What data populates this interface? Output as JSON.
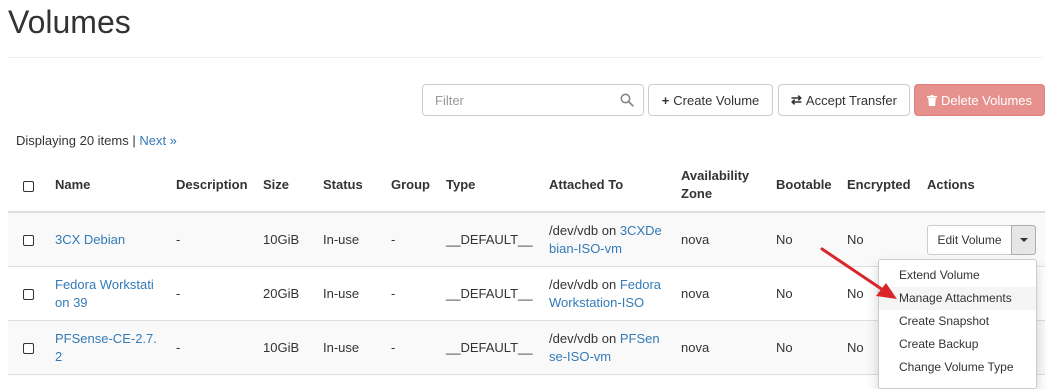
{
  "page": {
    "title": "Volumes"
  },
  "toolbar": {
    "filter_placeholder": "Filter",
    "create_label": "Create Volume",
    "accept_label": "Accept Transfer",
    "delete_label": "Delete Volumes"
  },
  "pagination": {
    "display_text": "Displaying 20 items | ",
    "next_label": "Next »"
  },
  "table": {
    "headers": {
      "name": "Name",
      "description": "Description",
      "size": "Size",
      "status": "Status",
      "group": "Group",
      "type": "Type",
      "attached": "Attached To",
      "zone_line1": "Availability",
      "zone_line2": "Zone",
      "bootable": "Bootable",
      "encrypted": "Encrypted",
      "actions": "Actions"
    },
    "rows": [
      {
        "name_l1": "3CX Debian",
        "name_l2": "",
        "description": "-",
        "size": "10GiB",
        "status": "In-use",
        "group": "-",
        "type": "__DEFAULT__",
        "attached_prefix": "/dev/vdb on ",
        "attached_l1": "3CXDe",
        "attached_l2": "bian-ISO-vm",
        "zone": "nova",
        "bootable": "No",
        "encrypted": "No",
        "action_label": "Edit Volume"
      },
      {
        "name_l1": "Fedora Workstati",
        "name_l2": "on 39",
        "description": "-",
        "size": "20GiB",
        "status": "In-use",
        "group": "-",
        "type": "__DEFAULT__",
        "attached_prefix": "/dev/vdb on ",
        "attached_l1": "Fedora",
        "attached_l2": "Workstation-ISO",
        "zone": "nova",
        "bootable": "No",
        "encrypted": "No"
      },
      {
        "name_l1": "PFSense-CE-2.7.",
        "name_l2": "2",
        "description": "-",
        "size": "10GiB",
        "status": "In-use",
        "group": "-",
        "type": "__DEFAULT__",
        "attached_prefix": "/dev/vdb on ",
        "attached_l1": "PFSen",
        "attached_l2": "se-ISO-vm",
        "zone": "nova",
        "bootable": "No",
        "encrypted": "No"
      }
    ]
  },
  "actions_menu": {
    "items": [
      "Extend Volume",
      "Manage Attachments",
      "Create Snapshot",
      "Create Backup",
      "Change Volume Type"
    ],
    "highlighted": "Manage Attachments"
  },
  "colors": {
    "link": "#337ab7",
    "danger": "#e7918f",
    "arrow": "#d9262b"
  }
}
